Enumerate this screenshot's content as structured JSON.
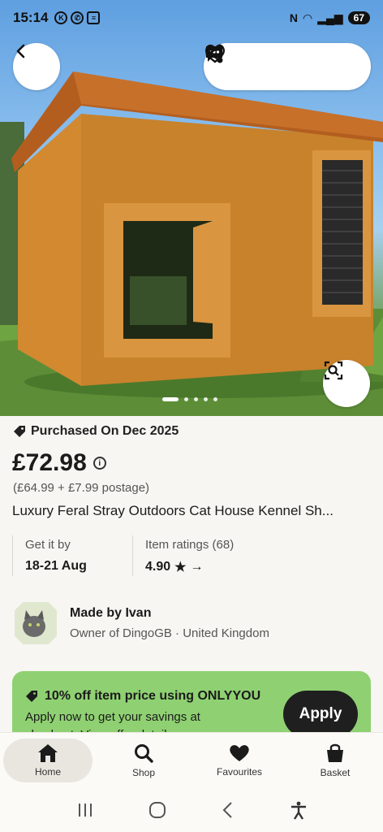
{
  "status_bar": {
    "time": "15:14",
    "battery": "67"
  },
  "product": {
    "purchased_note": "Purchased On Dec 2025",
    "price": "£72.98",
    "price_breakdown": "(£64.99 + £7.99 postage)",
    "title": "Luxury Feral Stray Outdoors Cat House Kennel Sh...",
    "image_count": 5,
    "active_image_index": 0
  },
  "delivery": {
    "label": "Get it by",
    "value": "18-21 Aug"
  },
  "ratings": {
    "label": "Item ratings (68)",
    "value": "4.90"
  },
  "seller": {
    "name": "Made by Ivan",
    "subtitle": "Owner of DingoGB · United Kingdom"
  },
  "promo": {
    "title": "10% off item price using ONLYYOU",
    "description": "Apply now to get your savings at checkout. View offer details",
    "button_label": "Apply"
  },
  "bottom_nav": [
    {
      "label": "Home",
      "icon": "home-icon",
      "active": true
    },
    {
      "label": "Shop",
      "icon": "search-icon",
      "active": false
    },
    {
      "label": "Favourites",
      "icon": "heart-icon",
      "active": false
    },
    {
      "label": "Basket",
      "icon": "basket-icon",
      "active": false
    }
  ],
  "colors": {
    "promo_bg": "#8fd172",
    "page_bg": "#f7f6f2",
    "button_dark": "#1f1f1f"
  }
}
